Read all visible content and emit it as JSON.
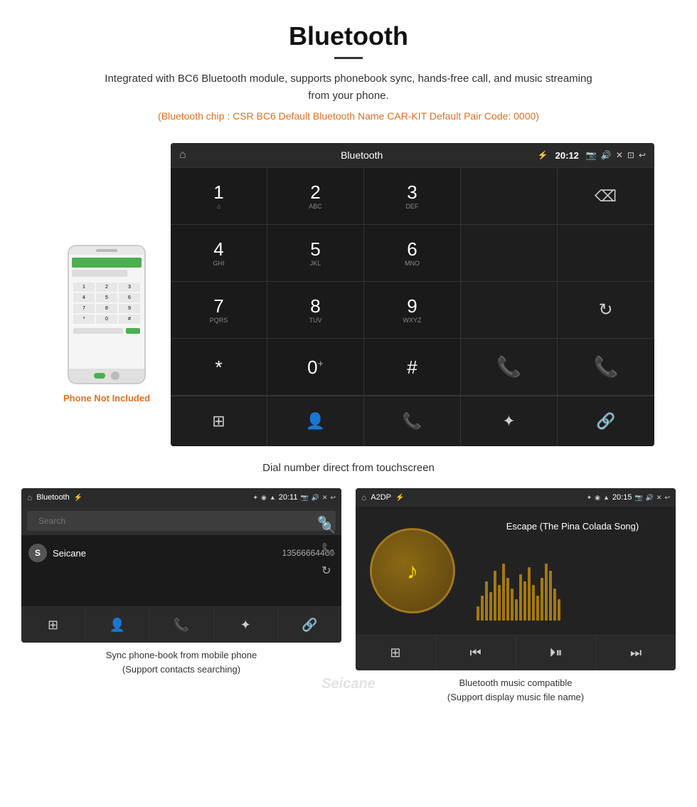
{
  "header": {
    "title": "Bluetooth",
    "description": "Integrated with BC6 Bluetooth module, supports phonebook sync, hands-free call, and music streaming from your phone.",
    "info_line": "(Bluetooth chip : CSR BC6   Default Bluetooth Name CAR-KIT    Default Pair Code: 0000)"
  },
  "main_screen": {
    "statusbar": {
      "home_icon": "⌂",
      "title": "Bluetooth",
      "usb_icon": "⚡",
      "bluetooth_icon": "✦",
      "location_icon": "◉",
      "signal_icon": "▲",
      "time": "20:12",
      "camera_icon": "📷",
      "volume_icon": "🔊",
      "close_icon": "✕",
      "back_icon": "↩"
    },
    "dialpad": [
      {
        "num": "1",
        "sub": "⌂⌂",
        "type": "key"
      },
      {
        "num": "2",
        "sub": "ABC",
        "type": "key"
      },
      {
        "num": "3",
        "sub": "DEF",
        "type": "key"
      },
      {
        "num": "",
        "sub": "",
        "type": "empty"
      },
      {
        "num": "⌫",
        "sub": "",
        "type": "backspace"
      },
      {
        "num": "4",
        "sub": "GHI",
        "type": "key"
      },
      {
        "num": "5",
        "sub": "JKL",
        "type": "key"
      },
      {
        "num": "6",
        "sub": "MNO",
        "type": "key"
      },
      {
        "num": "",
        "sub": "",
        "type": "empty"
      },
      {
        "num": "",
        "sub": "",
        "type": "empty"
      },
      {
        "num": "7",
        "sub": "PQRS",
        "type": "key"
      },
      {
        "num": "8",
        "sub": "TUV",
        "type": "key"
      },
      {
        "num": "9",
        "sub": "WXYZ",
        "type": "key"
      },
      {
        "num": "",
        "sub": "",
        "type": "empty"
      },
      {
        "num": "↻",
        "sub": "",
        "type": "refresh"
      },
      {
        "num": "*",
        "sub": "",
        "type": "key"
      },
      {
        "num": "0",
        "sub": "+",
        "type": "key"
      },
      {
        "num": "#",
        "sub": "",
        "type": "key"
      },
      {
        "num": "📞",
        "sub": "",
        "type": "call-green"
      },
      {
        "num": "📞",
        "sub": "",
        "type": "call-red"
      }
    ],
    "bottom_icons": [
      "⊞",
      "👤",
      "📞",
      "✦",
      "🔗"
    ],
    "caption": "Dial number direct from touchscreen"
  },
  "phone_aside": {
    "not_included_label": "Phone Not Included"
  },
  "phonebook_screen": {
    "statusbar_title": "Bluetooth",
    "time": "20:11",
    "search_placeholder": "Search",
    "contacts": [
      {
        "initial": "S",
        "name": "Seicane",
        "number": "13566664466"
      }
    ],
    "bottom_nav_icons": [
      "⊞",
      "👤",
      "📞",
      "✦",
      "🔗"
    ],
    "caption_line1": "Sync phone-book from mobile phone",
    "caption_line2": "(Support contacts searching)"
  },
  "music_screen": {
    "statusbar_title": "A2DP",
    "time": "20:15",
    "track_title": "Escape (The Pina Colada Song)",
    "eq_bars": [
      20,
      35,
      55,
      40,
      70,
      50,
      80,
      60,
      45,
      30,
      65,
      55,
      75,
      50,
      35,
      60,
      80,
      70,
      45,
      30
    ],
    "bottom_nav_icons": [
      "⊞",
      "⏮",
      "⏵⏸",
      "⏭"
    ],
    "caption_line1": "Bluetooth music compatible",
    "caption_line2": "(Support display music file name)"
  }
}
